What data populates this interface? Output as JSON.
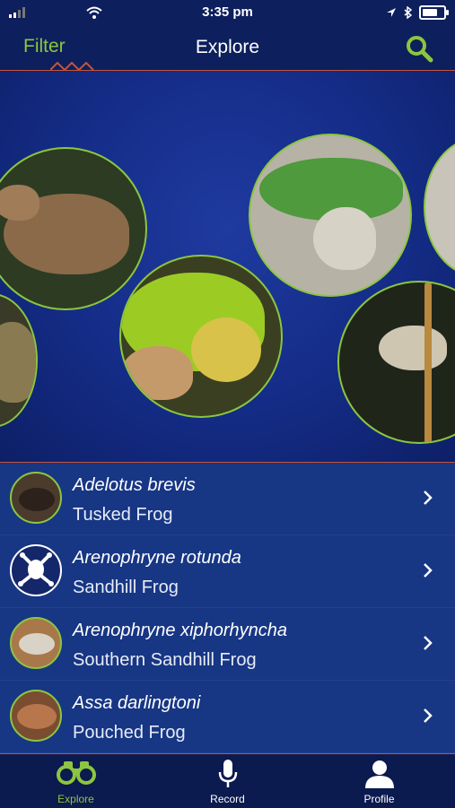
{
  "status": {
    "time": "3:35 pm"
  },
  "header": {
    "filter_label": "Filter",
    "title": "Explore"
  },
  "species": [
    {
      "scientific": "Adelotus brevis",
      "common": "Tusked Frog"
    },
    {
      "scientific": "Arenophryne rotunda",
      "common": "Sandhill Frog"
    },
    {
      "scientific": "Arenophryne xiphorhyncha",
      "common": "Southern Sandhill Frog"
    },
    {
      "scientific": "Assa darlingtoni",
      "common": "Pouched Frog"
    }
  ],
  "tabs": [
    {
      "label": "Explore",
      "icon": "binoculars-icon",
      "active": true
    },
    {
      "label": "Record",
      "icon": "microphone-icon",
      "active": false
    },
    {
      "label": "Profile",
      "icon": "person-icon",
      "active": false
    }
  ],
  "colors": {
    "accent": "#8cc63f",
    "background": "#0d1f5c",
    "divider": "#c3543c"
  }
}
